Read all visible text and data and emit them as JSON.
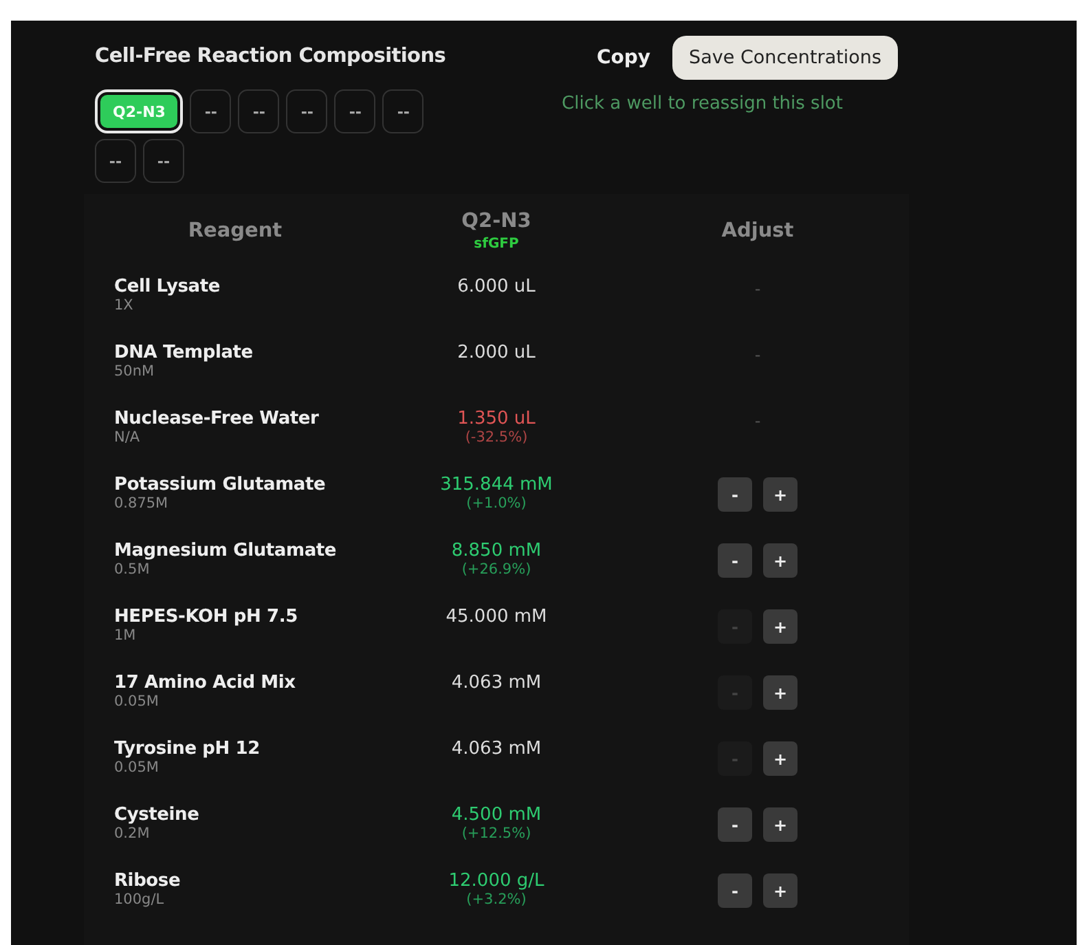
{
  "title": "Cell-Free Reaction Compositions",
  "actions": {
    "copy": "Copy",
    "save": "Save Concentrations"
  },
  "slots": [
    {
      "label": "Q2-N3",
      "selected": true
    },
    {
      "label": "--",
      "selected": false
    },
    {
      "label": "--",
      "selected": false
    },
    {
      "label": "--",
      "selected": false
    },
    {
      "label": "--",
      "selected": false
    },
    {
      "label": "--",
      "selected": false
    },
    {
      "label": "--",
      "selected": false
    },
    {
      "label": "--",
      "selected": false
    }
  ],
  "hint": "Click a well to reassign this slot",
  "table": {
    "columns": [
      {
        "label": "Reagent"
      },
      {
        "label": "Q2-N3",
        "sublabel": "sfGFP"
      },
      {
        "label": "Adjust"
      }
    ],
    "rows": [
      {
        "name": "Cell Lysate",
        "stock": "1X",
        "value": "6.000 uL",
        "color": "#dddddd",
        "kind": "dash",
        "placeholder": "-"
      },
      {
        "name": "DNA Template",
        "stock": "50nM",
        "value": "2.000 uL",
        "color": "#dddddd",
        "kind": "dash",
        "placeholder": "-"
      },
      {
        "name": "Nuclease-Free Water",
        "stock": "N/A",
        "value": "1.350 uL",
        "change": "(-32.5%)",
        "color": "#e05555",
        "kind": "dash",
        "placeholder": "-"
      },
      {
        "name": "Potassium Glutamate",
        "stock": "0.875M",
        "value": "315.844 mM",
        "change": "(+1.0%)",
        "color": "#2ecc71",
        "kind": "stepper",
        "minus": "-",
        "plus": "+",
        "minus_disabled": false
      },
      {
        "name": "Magnesium Glutamate",
        "stock": "0.5M",
        "value": "8.850 mM",
        "change": "(+26.9%)",
        "color": "#2ecc71",
        "kind": "stepper",
        "minus": "-",
        "plus": "+",
        "minus_disabled": false
      },
      {
        "name": "HEPES-KOH pH 7.5",
        "stock": "1M",
        "value": "45.000 mM",
        "color": "#dddddd",
        "kind": "stepper",
        "minus": "-",
        "plus": "+",
        "minus_disabled": true
      },
      {
        "name": "17 Amino Acid Mix",
        "stock": "0.05M",
        "value": "4.063 mM",
        "color": "#dddddd",
        "kind": "stepper",
        "minus": "-",
        "plus": "+",
        "minus_disabled": true
      },
      {
        "name": "Tyrosine pH 12",
        "stock": "0.05M",
        "value": "4.063 mM",
        "color": "#dddddd",
        "kind": "stepper",
        "minus": "-",
        "plus": "+",
        "minus_disabled": true
      },
      {
        "name": "Cysteine",
        "stock": "0.2M",
        "value": "4.500 mM",
        "change": "(+12.5%)",
        "color": "#2ecc71",
        "kind": "stepper",
        "minus": "-",
        "plus": "+",
        "minus_disabled": false
      },
      {
        "name": "Ribose",
        "stock": "100g/L",
        "value": "12.000 g/L",
        "change": "(+3.2%)",
        "color": "#2ecc71",
        "kind": "stepper",
        "minus": "-",
        "plus": "+",
        "minus_disabled": false
      }
    ]
  }
}
